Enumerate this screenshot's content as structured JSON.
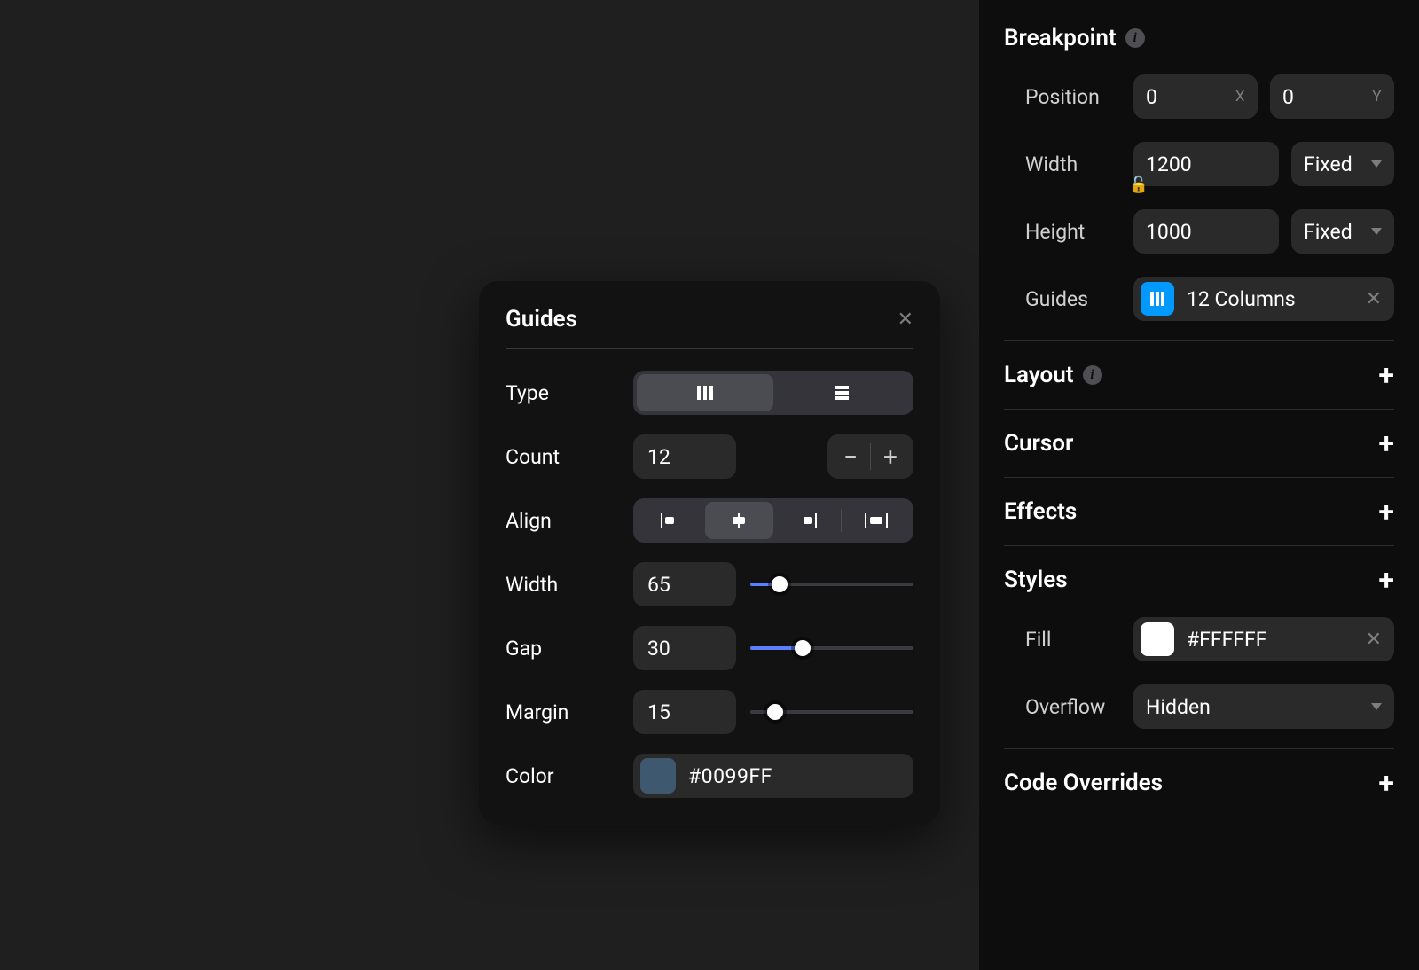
{
  "popover": {
    "title": "Guides",
    "type_label": "Type",
    "type_options": [
      "columns",
      "rows"
    ],
    "type_selected": "columns",
    "count_label": "Count",
    "count_value": "12",
    "align_label": "Align",
    "align_options": [
      "left",
      "center",
      "right",
      "stretch"
    ],
    "align_selected": "center",
    "width_label": "Width",
    "width_value": "65",
    "width_slider_pct": 18,
    "gap_label": "Gap",
    "gap_value": "30",
    "gap_slider_pct": 32,
    "margin_label": "Margin",
    "margin_value": "15",
    "margin_slider_pct": 15,
    "color_label": "Color",
    "color_value": "#0099FF"
  },
  "inspector": {
    "breakpoint": {
      "title": "Breakpoint",
      "position_label": "Position",
      "position_x": "0",
      "position_x_suffix": "X",
      "position_y": "0",
      "position_y_suffix": "Y",
      "width_label": "Width",
      "width_value": "1200",
      "width_mode": "Fixed",
      "height_label": "Height",
      "height_value": "1000",
      "height_mode": "Fixed",
      "guides_label": "Guides",
      "guides_value": "12 Columns"
    },
    "layout": {
      "title": "Layout"
    },
    "cursor": {
      "title": "Cursor"
    },
    "effects": {
      "title": "Effects"
    },
    "styles": {
      "title": "Styles",
      "fill_label": "Fill",
      "fill_value": "#FFFFFF",
      "overflow_label": "Overflow",
      "overflow_value": "Hidden"
    },
    "code_overrides": {
      "title": "Code Overrides"
    }
  }
}
